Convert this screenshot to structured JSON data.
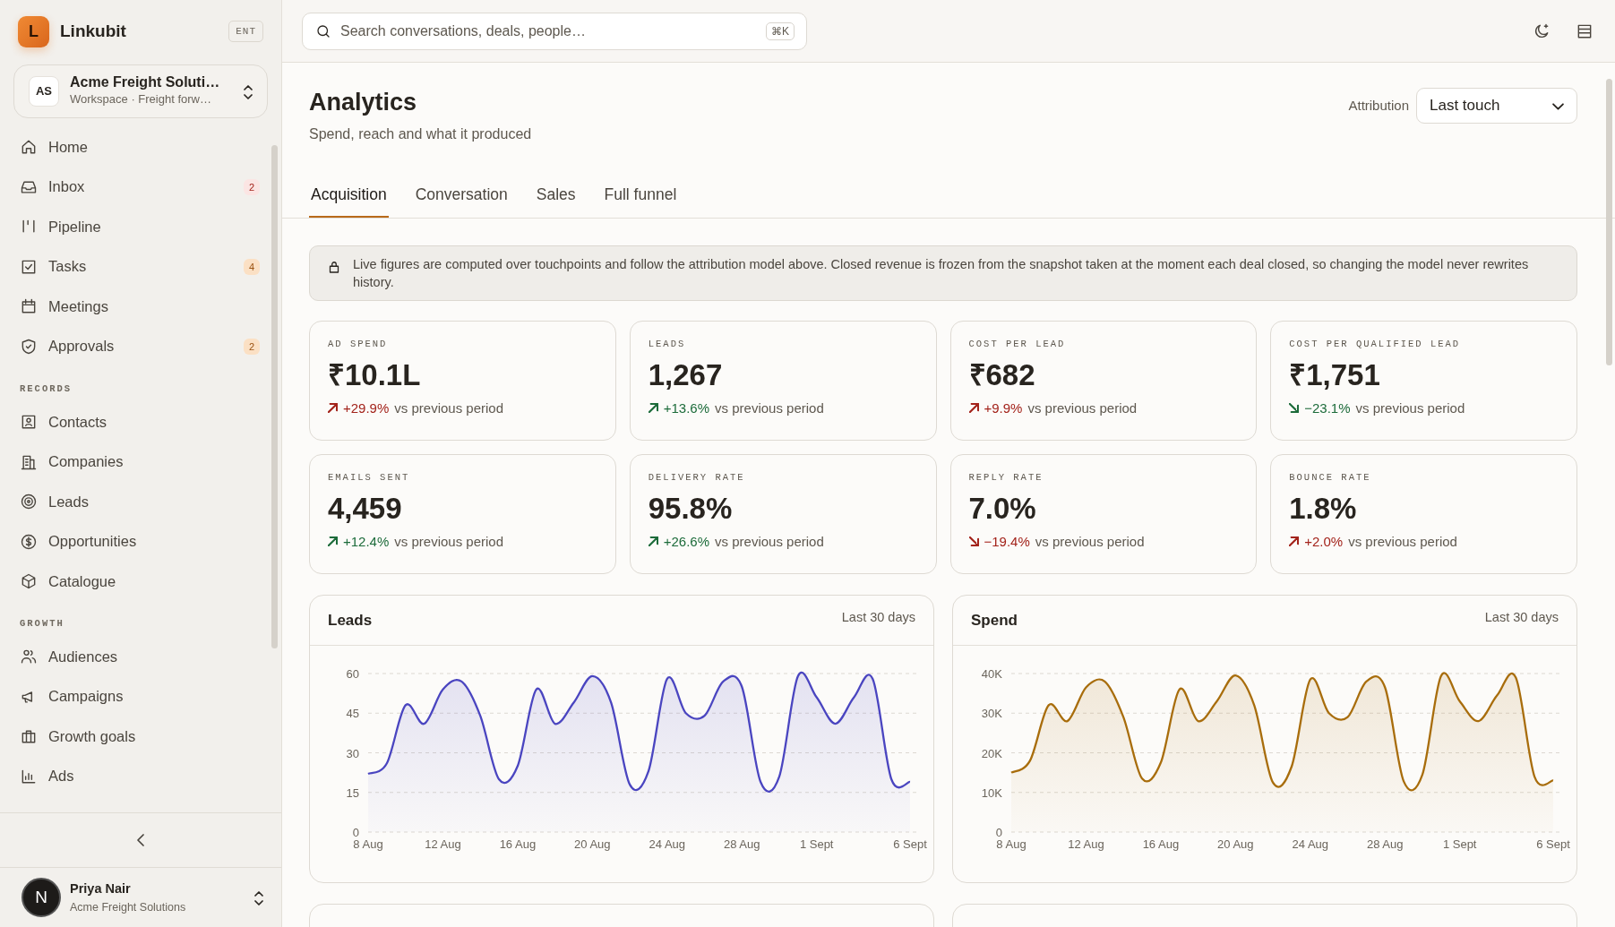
{
  "sidebar": {
    "brand": {
      "logo_letter": "L",
      "name": "Linkubit",
      "plan": "ENT"
    },
    "workspace": {
      "initials": "AS",
      "name": "Acme Freight Soluti…",
      "subtitle": "Workspace · Freight forw…"
    },
    "sections": [
      {
        "items": [
          {
            "label": "Home"
          },
          {
            "label": "Inbox",
            "badge": "2",
            "badge_urgent": true
          },
          {
            "label": "Pipeline"
          },
          {
            "label": "Tasks",
            "badge": "4",
            "badge_urgent": false
          },
          {
            "label": "Meetings"
          },
          {
            "label": "Approvals",
            "badge": "2",
            "badge_urgent": false
          }
        ]
      },
      {
        "title": "RECORDS",
        "items": [
          {
            "label": "Contacts"
          },
          {
            "label": "Companies"
          },
          {
            "label": "Leads"
          },
          {
            "label": "Opportunities"
          },
          {
            "label": "Catalogue"
          }
        ]
      },
      {
        "title": "GROWTH",
        "items": [
          {
            "label": "Audiences"
          },
          {
            "label": "Campaigns"
          },
          {
            "label": "Growth goals"
          },
          {
            "label": "Ads"
          }
        ]
      }
    ],
    "user": {
      "avatar_initial": "N",
      "name": "Priya Nair",
      "org": "Acme Freight Solutions"
    }
  },
  "topbar": {
    "search": {
      "placeholder": "Search conversations, deals, people…",
      "shortcut": "⌘K"
    }
  },
  "page": {
    "title": "Analytics",
    "subtitle": "Spend, reach and what it produced",
    "attribution": {
      "label": "Attribution",
      "value": "Last touch"
    },
    "tabs": [
      {
        "label": "Acquisition",
        "selected": true
      },
      {
        "label": "Conversation",
        "selected": false
      },
      {
        "label": "Sales",
        "selected": false
      },
      {
        "label": "Full funnel",
        "selected": false
      }
    ],
    "notice": "Live figures are computed over touchpoints and follow the attribution model above. Closed revenue is frozen from the snapshot taken at the moment each deal closed, so changing the model never rewrites history.",
    "kpis": [
      {
        "label": "AD SPEND",
        "value": "₹10.1L",
        "delta": "+29.9%",
        "rising": true,
        "favorable": false,
        "caption": "vs previous period"
      },
      {
        "label": "LEADS",
        "value": "1,267",
        "delta": "+13.6%",
        "rising": true,
        "favorable": true,
        "caption": "vs previous period"
      },
      {
        "label": "COST PER LEAD",
        "value": "₹682",
        "delta": "+9.9%",
        "rising": true,
        "favorable": false,
        "caption": "vs previous period"
      },
      {
        "label": "COST PER QUALIFIED LEAD",
        "value": "₹1,751",
        "delta": "−23.1%",
        "rising": false,
        "favorable": true,
        "caption": "vs previous period"
      },
      {
        "label": "EMAILS SENT",
        "value": "4,459",
        "delta": "+12.4%",
        "rising": true,
        "favorable": true,
        "caption": "vs previous period"
      },
      {
        "label": "DELIVERY RATE",
        "value": "95.8%",
        "delta": "+26.6%",
        "rising": true,
        "favorable": true,
        "caption": "vs previous period"
      },
      {
        "label": "REPLY RATE",
        "value": "7.0%",
        "delta": "−19.4%",
        "rising": false,
        "favorable": false,
        "caption": "vs previous period"
      },
      {
        "label": "BOUNCE RATE",
        "value": "1.8%",
        "delta": "+2.0%",
        "rising": true,
        "favorable": false,
        "caption": "vs previous period"
      }
    ],
    "charts": [
      {
        "period": "Last 30 days",
        "chart_data": {
          "type": "area",
          "title": "Leads",
          "categories": [
            "8 Aug",
            null,
            null,
            null,
            "12 Aug",
            null,
            null,
            null,
            "16 Aug",
            null,
            null,
            null,
            "20 Aug",
            null,
            null,
            null,
            "24 Aug",
            null,
            null,
            null,
            "28 Aug",
            null,
            null,
            null,
            "1 Sept",
            null,
            null,
            null,
            null,
            "6 Sept"
          ],
          "grid": true,
          "series": [
            {
              "color": "#4a45c0",
              "values": [
                22,
                26,
                48,
                41,
                54,
                57,
                44,
                20,
                25,
                54,
                41,
                49,
                59,
                49,
                18,
                23,
                58,
                45,
                44,
                57,
                55,
                19,
                21,
                59,
                51,
                41,
                51,
                58,
                20,
                19
              ]
            }
          ],
          "ylim": [
            0,
            60
          ],
          "yticks": [
            0,
            15,
            30,
            45,
            60
          ]
        }
      },
      {
        "period": "Last 30 days",
        "chart_data": {
          "type": "area",
          "title": "Spend",
          "categories": [
            "8 Aug",
            null,
            null,
            null,
            "12 Aug",
            null,
            null,
            null,
            "16 Aug",
            null,
            null,
            null,
            "20 Aug",
            null,
            null,
            null,
            "24 Aug",
            null,
            null,
            null,
            "28 Aug",
            null,
            null,
            null,
            "1 Sept",
            null,
            null,
            null,
            null,
            "6 Sept"
          ],
          "grid": true,
          "series": [
            {
              "color": "#a86d0c",
              "values": [
                15000,
                18000,
                32000,
                28000,
                36500,
                38000,
                29000,
                13500,
                17500,
                36000,
                28000,
                33000,
                39500,
                32000,
                12500,
                16500,
                38500,
                30000,
                29000,
                38000,
                36500,
                12800,
                14500,
                39400,
                33000,
                28000,
                34500,
                39000,
                14000,
                13000
              ]
            }
          ],
          "ylim": [
            0,
            40000
          ],
          "yticks": [
            {
              "value": 0,
              "label": "0"
            },
            {
              "value": 10000,
              "label": "10K"
            },
            {
              "value": 20000,
              "label": "20K"
            },
            {
              "value": 30000,
              "label": "30K"
            },
            {
              "value": 40000,
              "label": "40K"
            }
          ]
        }
      }
    ]
  }
}
